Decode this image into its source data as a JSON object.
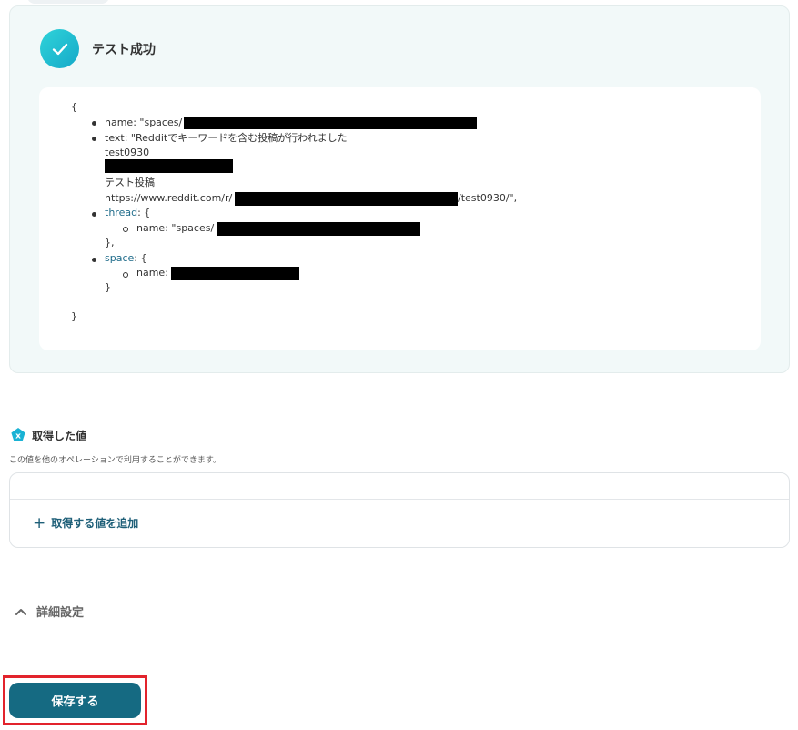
{
  "panel": {
    "title": "テスト成功"
  },
  "code": {
    "open_brace": "{",
    "name_line": "name: \"spaces/",
    "text_line": "text: \"Redditでキーワードを含む投稿が行われました",
    "text_line2": "test0930",
    "text_line4": "テスト投稿",
    "url_prefix": "https://www.reddit.com/r/",
    "url_suffix": "/test0930/\",",
    "thread_key": "thread",
    "thread_rest": ": {",
    "thread_name": "name: \"spaces/",
    "thread_close": "},",
    "space_key": "space",
    "space_rest": ": {",
    "space_name": "name:",
    "space_close": "}",
    "close_brace": "}"
  },
  "section": {
    "icon_letter": "x",
    "title": "取得した値",
    "description": "この値を他のオペレーションで利用することができます。"
  },
  "values": {
    "add_label": "取得する値を追加",
    "add_icon": "+"
  },
  "detail": {
    "label": "詳細設定"
  },
  "footer": {
    "save_label": "保存する"
  },
  "colors": {
    "accent": "#156a82",
    "success": "#2fd3d9",
    "highlight": "#e2232c"
  }
}
